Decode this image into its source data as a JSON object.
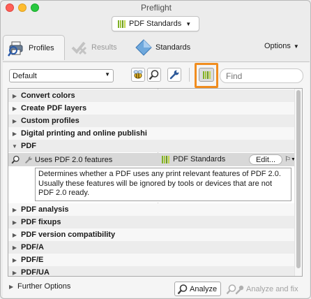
{
  "window": {
    "title": "Preflight"
  },
  "standards_dropdown": {
    "label": "PDF Standards"
  },
  "tabs": [
    {
      "label": "Profiles",
      "icon": "printer-magnifier-icon",
      "selected": true
    },
    {
      "label": "Results",
      "icon": "checkmark-cross-icon",
      "selected": false
    },
    {
      "label": "Standards",
      "icon": "diamond-icon",
      "selected": false
    }
  ],
  "options_label": "Options",
  "profile_select": {
    "value": "Default"
  },
  "find": {
    "placeholder": "Find"
  },
  "tree": {
    "groups_top": [
      {
        "label": "Convert colors",
        "expanded": false
      },
      {
        "label": "Create PDF layers",
        "expanded": false
      },
      {
        "label": "Custom profiles",
        "expanded": false
      },
      {
        "label": "Digital printing and online publishi",
        "expanded": false
      },
      {
        "label": "PDF",
        "expanded": true
      }
    ],
    "check": {
      "label": "Uses PDF 2.0 features",
      "standard": "PDF Standards",
      "edit_label": "Edit...",
      "description": "Determines whether a PDF uses any print relevant features of PDF 2.0. Usually these features will be ignored by tools or devices that are not PDF 2.0 ready."
    },
    "groups_bottom": [
      {
        "label": "PDF analysis",
        "expanded": false
      },
      {
        "label": "PDF fixups",
        "expanded": false
      },
      {
        "label": "PDF version compatibility",
        "expanded": false
      },
      {
        "label": "PDF/A",
        "expanded": false
      },
      {
        "label": "PDF/E",
        "expanded": false
      },
      {
        "label": "PDF/UA",
        "expanded": false
      }
    ]
  },
  "footer": {
    "further_options": "Further Options",
    "analyze": "Analyze",
    "analyze_fix": "Analyze and fix"
  },
  "colors": {
    "highlight": "#f08d1f",
    "standard_green": "#7fb028"
  }
}
